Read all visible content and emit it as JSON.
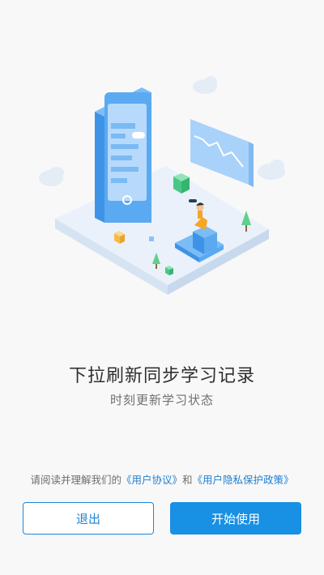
{
  "onboarding": {
    "title": "下拉刷新同步学习记录",
    "subtitle": "时刻更新学习状态"
  },
  "agreement": {
    "prefix": "请阅读并理解我们的",
    "user_agreement": "《用户协议》",
    "conjunction": "和",
    "privacy_policy": "《用户隐私保护政策》"
  },
  "buttons": {
    "exit_label": "退出",
    "start_label": "开始使用"
  },
  "colors": {
    "accent": "#1890e4",
    "link": "#1f7fd0",
    "background": "#f8f8f9"
  }
}
